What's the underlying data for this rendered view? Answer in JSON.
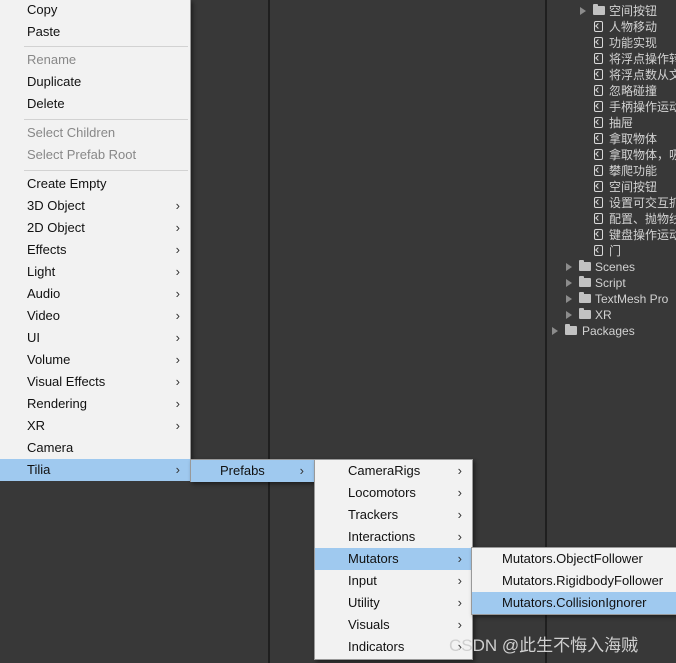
{
  "context_menu": {
    "group1": [
      "Copy",
      "Paste"
    ],
    "group2": [
      "Rename",
      "Duplicate",
      "Delete"
    ],
    "group3": [
      "Select Children",
      "Select Prefab Root"
    ],
    "group4": [
      {
        "label": "Create Empty"
      },
      {
        "label": "3D Object",
        "submenu": true
      },
      {
        "label": "2D Object",
        "submenu": true
      },
      {
        "label": "Effects",
        "submenu": true
      },
      {
        "label": "Light",
        "submenu": true
      },
      {
        "label": "Audio",
        "submenu": true
      },
      {
        "label": "Video",
        "submenu": true
      },
      {
        "label": "UI",
        "submenu": true
      },
      {
        "label": "Volume",
        "submenu": true
      },
      {
        "label": "Visual Effects",
        "submenu": true
      },
      {
        "label": "Rendering",
        "submenu": true
      },
      {
        "label": "XR",
        "submenu": true
      },
      {
        "label": "Camera"
      },
      {
        "label": "Tilia",
        "submenu": true,
        "highlighted": true
      }
    ]
  },
  "tilia_menu": {
    "items": [
      "Prefabs"
    ]
  },
  "prefabs_menu": {
    "items": [
      "CameraRigs",
      "Locomotors",
      "Trackers",
      "Interactions",
      "Mutators",
      "Input",
      "Utility",
      "Visuals",
      "Indicators"
    ],
    "highlighted": "Mutators"
  },
  "mutators_menu": {
    "items": [
      "Mutators.ObjectFollower",
      "Mutators.RigidbodyFollower",
      "Mutators.CollisionIgnorer"
    ],
    "highlighted": "Mutators.CollisionIgnorer"
  },
  "project_tree": {
    "top_folder": "空间按钮",
    "scripts": [
      "人物移动",
      "功能实现",
      "将浮点操作转",
      "将浮点数从文",
      "忽略碰撞",
      "手柄操作运动",
      "抽屉",
      "拿取物体",
      "拿取物体，吸",
      "攀爬功能",
      "空间按钮",
      "设置可交互抓",
      "配置、抛物线",
      "键盘操作运动",
      "门"
    ],
    "folders": [
      "Scenes",
      "Script",
      "TextMesh Pro",
      "XR"
    ],
    "root": "Packages"
  },
  "watermark": "CSDN @此生不悔入海贼",
  "colors": {
    "highlight": "#9fc9ef",
    "menu_bg": "#f2f2f2",
    "editor_bg": "#383838"
  }
}
